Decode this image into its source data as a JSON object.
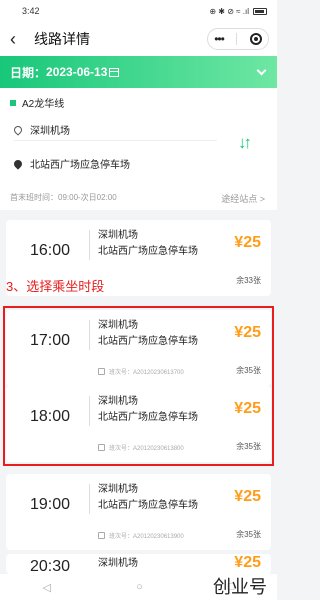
{
  "status": {
    "time": "3:42",
    "icons": "⊕ ✱ ⊘ ≈ .ıl"
  },
  "header": {
    "title": "线路详情"
  },
  "date_bar": {
    "label": "日期：",
    "date": "2023-06-13"
  },
  "route": {
    "name": "A2龙华线",
    "from": "深圳机场",
    "to": "北站西广场应急停车场",
    "hours": "首末班时间：09:00-次日02:00",
    "via_link": "途经站点 >"
  },
  "annotation": "3、选择乘坐时段",
  "trips": [
    {
      "time": "16:00",
      "from": "深圳机场",
      "to": "北站西广场应急停车场",
      "price": "¥25",
      "remain": "余33张",
      "bus_no": ""
    },
    {
      "time": "17:00",
      "from": "深圳机场",
      "to": "北站西广场应急停车场",
      "price": "¥25",
      "remain": "余35张",
      "bus_no": "班次号：A20120230613700"
    },
    {
      "time": "18:00",
      "from": "深圳机场",
      "to": "北站西广场应急停车场",
      "price": "¥25",
      "remain": "余35张",
      "bus_no": "班次号：A20120230613800"
    },
    {
      "time": "19:00",
      "from": "深圳机场",
      "to": "北站西广场应急停车场",
      "price": "¥25",
      "remain": "余35张",
      "bus_no": "班次号：A20120230613900"
    },
    {
      "time": "20:30",
      "from": "深圳机场",
      "to": "",
      "price": "¥25",
      "remain": "",
      "bus_no": ""
    }
  ],
  "bottom_nav": {
    "back": "◁",
    "home": "○",
    "recent": "□"
  },
  "watermark": "创业号"
}
